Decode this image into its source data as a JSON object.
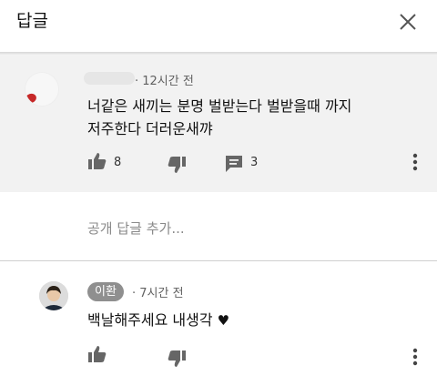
{
  "header": {
    "title": "답글",
    "close_icon": "close-icon"
  },
  "parent_comment": {
    "time": "· 12시간 전",
    "text_line1": "너같은 새끼는 분명 벌받는다 벌받을때 까지",
    "text_line2": "저주한다 더러운새꺄",
    "like_count": "8",
    "reply_count": "3"
  },
  "reply_input": {
    "placeholder": "공개 답글 추가..."
  },
  "reply": {
    "author": "이환",
    "time": "· 7시간 전",
    "text": "백날해주세요 내생각",
    "heart": "♥"
  },
  "colors": {
    "parent_background": "#f2f2f2",
    "icon_gray": "#666666",
    "chip_gray": "#8f8f8f"
  }
}
